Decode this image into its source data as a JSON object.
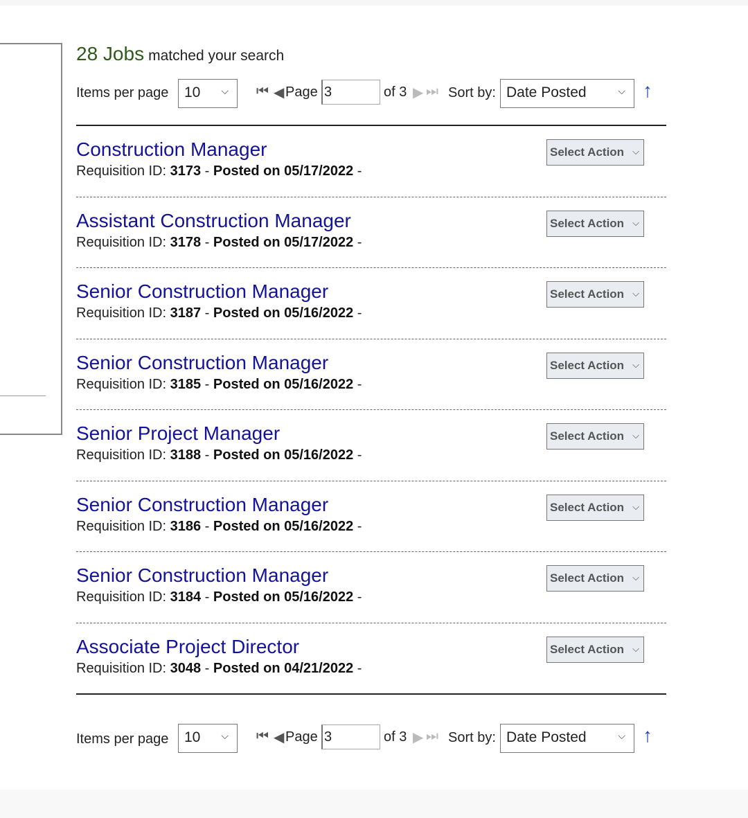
{
  "results": {
    "count": "28 Jobs",
    "suffix": "matched your search"
  },
  "pager": {
    "items_per_page_label": "Items per page",
    "items_per_page_value": "10",
    "page_label": "Page",
    "page_value": "3",
    "of_label": "of 3",
    "sort_label": "Sort by:",
    "sort_value": "Date Posted",
    "sort_direction_glyph": "🡑"
  },
  "icons": {
    "first": "⏮",
    "prev": "◀",
    "next": "▶",
    "last": "⏭",
    "caret": "⌵",
    "arrow": "↑"
  },
  "jobs": [
    {
      "title": "Construction Manager",
      "req_label": "Requisition ID:",
      "req_id": "3173",
      "posted": "Posted on 05/17/2022",
      "action": "Select Action"
    },
    {
      "title": "Assistant Construction Manager",
      "req_label": "Requisition ID:",
      "req_id": "3178",
      "posted": "Posted on 05/17/2022",
      "action": "Select Action"
    },
    {
      "title": "Senior Construction Manager",
      "req_label": "Requisition ID:",
      "req_id": "3187",
      "posted": "Posted on 05/16/2022",
      "action": "Select Action"
    },
    {
      "title": "Senior Construction Manager",
      "req_label": "Requisition ID:",
      "req_id": "3185",
      "posted": "Posted on 05/16/2022",
      "action": "Select Action"
    },
    {
      "title": "Senior Project Manager",
      "req_label": "Requisition ID:",
      "req_id": "3188",
      "posted": "Posted on 05/16/2022",
      "action": "Select Action"
    },
    {
      "title": "Senior Construction Manager",
      "req_label": "Requisition ID:",
      "req_id": "3186",
      "posted": "Posted on 05/16/2022",
      "action": "Select Action"
    },
    {
      "title": "Senior Construction Manager",
      "req_label": "Requisition ID:",
      "req_id": "3184",
      "posted": "Posted on 05/16/2022",
      "action": "Select Action"
    },
    {
      "title": "Associate Project Director",
      "req_label": "Requisition ID:",
      "req_id": "3048",
      "posted": "Posted on 04/21/2022",
      "action": "Select Action"
    }
  ]
}
